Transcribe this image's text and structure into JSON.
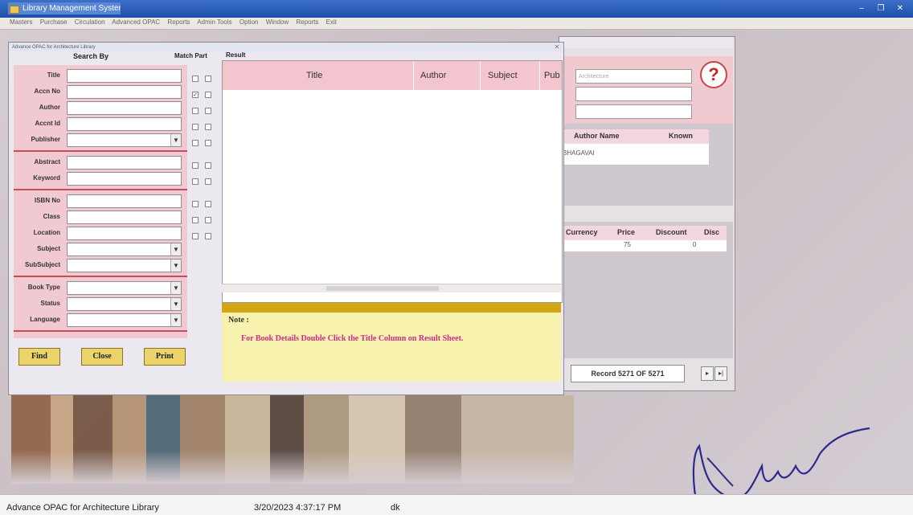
{
  "app": {
    "title": "Library Management System",
    "window_buttons": [
      "–",
      "❐",
      "✕"
    ]
  },
  "menu": [
    "Masters",
    "Purchase",
    "Circulation",
    "Advanced OPAC",
    "Reports",
    "Admin Tools",
    "Option",
    "Window",
    "Reports",
    "Exit"
  ],
  "main_window": {
    "title": "Advance OPAC for Architecture Library",
    "search_by_label": "Search By",
    "match_part_label": "Match Part",
    "result_label": "Result",
    "fields": [
      {
        "label": "Title",
        "type": "text"
      },
      {
        "label": "Accn No",
        "type": "text"
      },
      {
        "label": "Author",
        "type": "text"
      },
      {
        "label": "Accnt Id",
        "type": "text"
      },
      {
        "label": "Publisher",
        "type": "select"
      },
      {
        "label": "Abstract",
        "type": "text"
      },
      {
        "label": "Keyword",
        "type": "text"
      },
      {
        "label": "ISBN No",
        "type": "text"
      },
      {
        "label": "Class",
        "type": "text"
      },
      {
        "label": "Location",
        "type": "text"
      },
      {
        "label": "Subject",
        "type": "select"
      },
      {
        "label": "SubSubject",
        "type": "select"
      },
      {
        "label": "Book Type",
        "type": "select"
      },
      {
        "label": "Status",
        "type": "select"
      },
      {
        "label": "Language",
        "type": "select"
      }
    ],
    "buttons": {
      "find": "Find",
      "close": "Close",
      "print": "Print"
    },
    "result_columns": [
      "Title",
      "Author",
      "Subject",
      "Pub"
    ],
    "note_label": "Note :",
    "note_text": "For Book Details Double Click the Title Column on Result Sheet."
  },
  "back_window": {
    "field_hint": "Architecture",
    "author_table": {
      "columns": [
        "Author Name",
        "Known"
      ],
      "rows": [
        [
          "BHAGAVAI",
          ""
        ]
      ]
    },
    "price_table": {
      "columns": [
        "Currency",
        "Price",
        "Discount",
        "Disc"
      ],
      "rows": [
        [
          "",
          "75",
          "",
          "0"
        ]
      ]
    },
    "record_text": "Record 5271 OF 5271",
    "nav": [
      "▸",
      "▸|"
    ]
  },
  "status_bar": {
    "module": "Advance OPAC for Architecture Library",
    "datetime": "3/20/2023 4:37:17 PM",
    "user": "dk"
  }
}
